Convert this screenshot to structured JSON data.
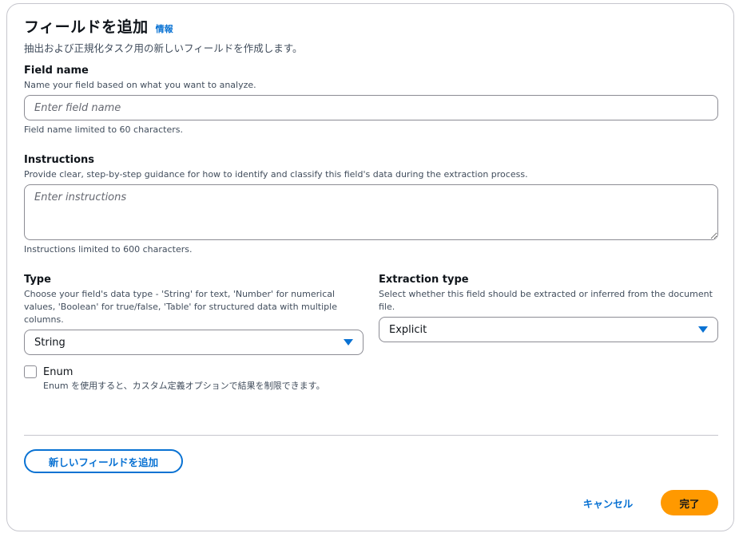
{
  "header": {
    "title": "フィールドを追加",
    "info_link": "情報",
    "subtitle": "抽出および正規化タスク用の新しいフィールドを作成します。"
  },
  "field_name": {
    "label": "Field name",
    "description": "Name your field based on what you want to analyze.",
    "placeholder": "Enter field name",
    "value": "",
    "constraint": "Field name limited to 60 characters."
  },
  "instructions": {
    "label": "Instructions",
    "description": "Provide clear, step-by-step guidance for how to identify and classify this field's data during the extraction process.",
    "placeholder": "Enter instructions",
    "value": "",
    "constraint": "Instructions limited to 600 characters."
  },
  "type": {
    "label": "Type",
    "description_lines": [
      "Choose your field's data type - 'String' for text, 'Number' for numerical",
      "values, 'Boolean' for true/false, 'Table' for structured data with multiple",
      "columns."
    ],
    "selected": "String",
    "caret_icon": "caret-down-icon"
  },
  "extraction_type": {
    "label": "Extraction type",
    "description_lines": [
      "Select whether this field should be extracted or inferred from the document",
      "file."
    ],
    "selected": "Explicit",
    "caret_icon": "caret-down-icon"
  },
  "enum": {
    "label": "Enum",
    "checked": false,
    "description": "Enum を使用すると、カスタム定義オプションで結果を制限できます。"
  },
  "buttons": {
    "add_field": "新しいフィールドを追加",
    "cancel": "キャンセル",
    "done": "完了"
  },
  "colors": {
    "accent": "#0972d3",
    "primary_button": "#ff9900",
    "border": "#8c8c94"
  }
}
